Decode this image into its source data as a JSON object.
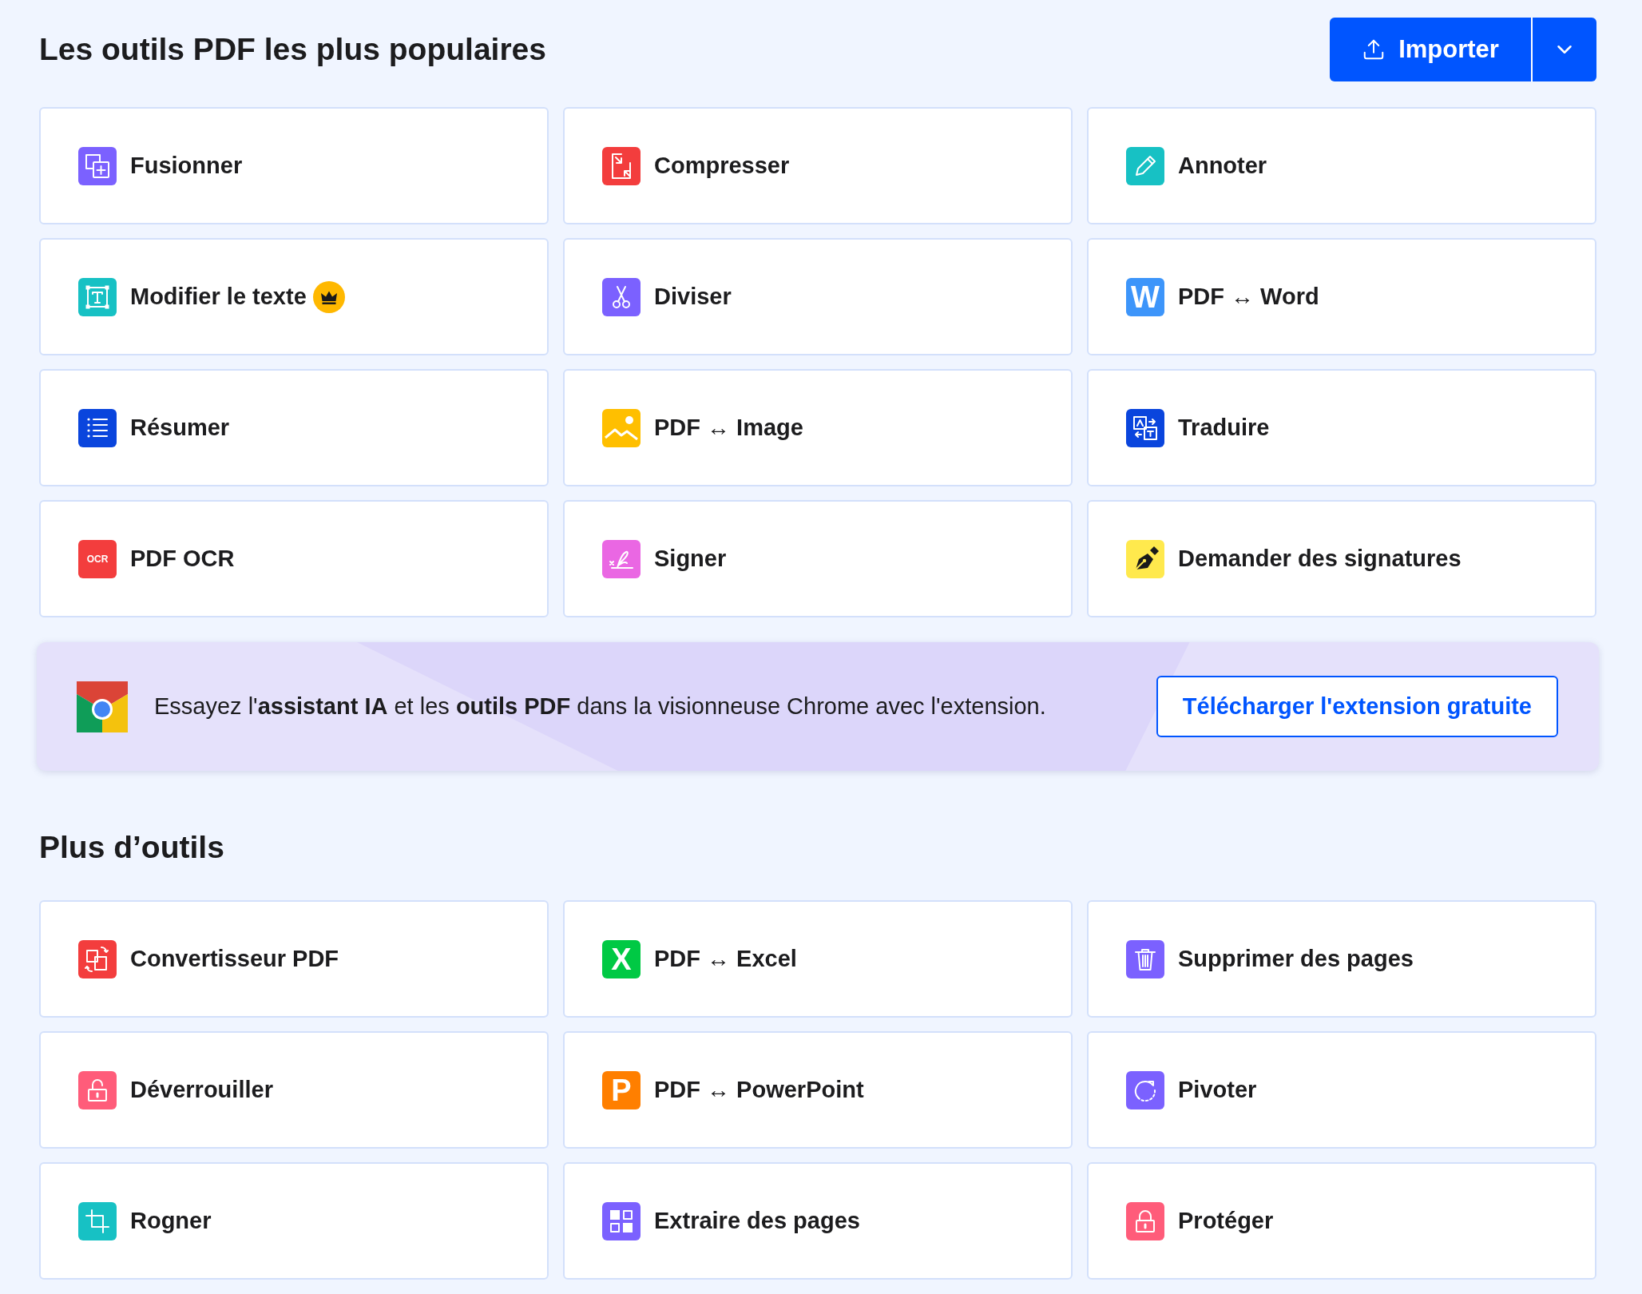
{
  "popular": {
    "title": "Les outils PDF les plus populaires",
    "import_button": {
      "label": "Importer"
    },
    "tools": [
      {
        "label": "Fusionner",
        "kind": "merge",
        "color": "#7b61ff",
        "premium": false
      },
      {
        "label": "Compresser",
        "kind": "compress",
        "color": "#f33d3d",
        "premium": false
      },
      {
        "label": "Annoter",
        "kind": "annotate",
        "color": "#17c1c4",
        "premium": false
      },
      {
        "label": "Modifier le texte",
        "kind": "edit_text",
        "color": "#17c1c4",
        "premium": true
      },
      {
        "label": "Diviser",
        "kind": "split",
        "color": "#7b61ff",
        "premium": false
      },
      {
        "label": "PDF ↔ Word",
        "kind": "letter",
        "letter": "W",
        "color": "#3d95fa",
        "premium": false
      },
      {
        "label": "Résumer",
        "kind": "summarize",
        "color": "#0a45dd",
        "premium": false
      },
      {
        "label": "PDF ↔ Image",
        "kind": "image",
        "color": "#ffbf00",
        "premium": false
      },
      {
        "label": "Traduire",
        "kind": "translate",
        "color": "#0a45dd",
        "premium": false
      },
      {
        "label": "PDF OCR",
        "kind": "letter",
        "letter": "OCR",
        "color": "#f33d3d",
        "premium": false
      },
      {
        "label": "Signer",
        "kind": "sign",
        "color": "#ea67e3",
        "premium": false
      },
      {
        "label": "Demander des signatures",
        "kind": "request_sign",
        "color": "#ffe94d",
        "premium": false
      }
    ]
  },
  "banner": {
    "text": "Essayez l'**assistant IA** et les **outils PDF** dans la visionneuse Chrome avec l'extension.",
    "button": "Télécharger l'extension gratuite"
  },
  "more": {
    "title": "Plus d’outils",
    "tools": [
      {
        "label": "Convertisseur PDF",
        "kind": "convert",
        "color": "#f33d3d",
        "premium": false
      },
      {
        "label": "PDF ↔ Excel",
        "kind": "letter",
        "letter": "X",
        "color": "#00c944",
        "premium": false
      },
      {
        "label": "Supprimer des pages",
        "kind": "trash",
        "color": "#7b61ff",
        "premium": false
      },
      {
        "label": "Déverrouiller",
        "kind": "unlock",
        "color": "#ff5c7a",
        "premium": false
      },
      {
        "label": "PDF ↔ PowerPoint",
        "kind": "letter",
        "letter": "P",
        "color": "#ff7f00",
        "premium": false
      },
      {
        "label": "Pivoter",
        "kind": "rotate",
        "color": "#7b61ff",
        "premium": false
      },
      {
        "label": "Rogner",
        "kind": "crop",
        "color": "#17c1c4",
        "premium": false
      },
      {
        "label": "Extraire des pages",
        "kind": "extract",
        "color": "#7b61ff",
        "premium": false
      },
      {
        "label": "Protéger",
        "kind": "protect",
        "color": "#ff5c7a",
        "premium": false
      }
    ]
  }
}
